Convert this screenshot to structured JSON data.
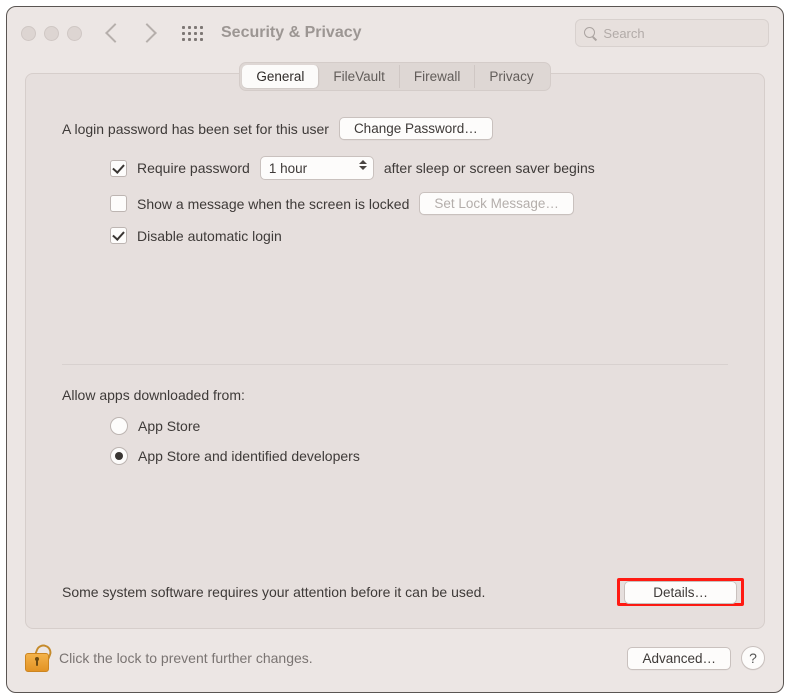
{
  "toolbar": {
    "title": "Security & Privacy",
    "search_placeholder": "Search"
  },
  "tabs": {
    "general": "General",
    "filevault": "FileVault",
    "firewall": "Firewall",
    "privacy": "Privacy",
    "active": "general"
  },
  "general": {
    "login_password_set": "A login password has been set for this user",
    "change_password_btn": "Change Password…",
    "require_password": {
      "checked": true,
      "label_before": "Require password",
      "delay_value": "1 hour",
      "label_after": "after sleep or screen saver begins"
    },
    "show_lock_message": {
      "checked": false,
      "label": "Show a message when the screen is locked",
      "set_btn": "Set Lock Message…",
      "set_btn_enabled": false
    },
    "disable_auto_login": {
      "checked": true,
      "label": "Disable automatic login"
    },
    "allow_apps_label": "Allow apps downloaded from:",
    "allow_apps": {
      "app_store": "App Store",
      "app_store_and_devs": "App Store and identified developers",
      "selected": "app_store_and_devs"
    },
    "attention_text": "Some system software requires your attention before it can be used.",
    "details_btn": "Details…"
  },
  "footer": {
    "lock_text": "Click the lock to prevent further changes.",
    "advanced_btn": "Advanced…",
    "help_label": "?"
  }
}
